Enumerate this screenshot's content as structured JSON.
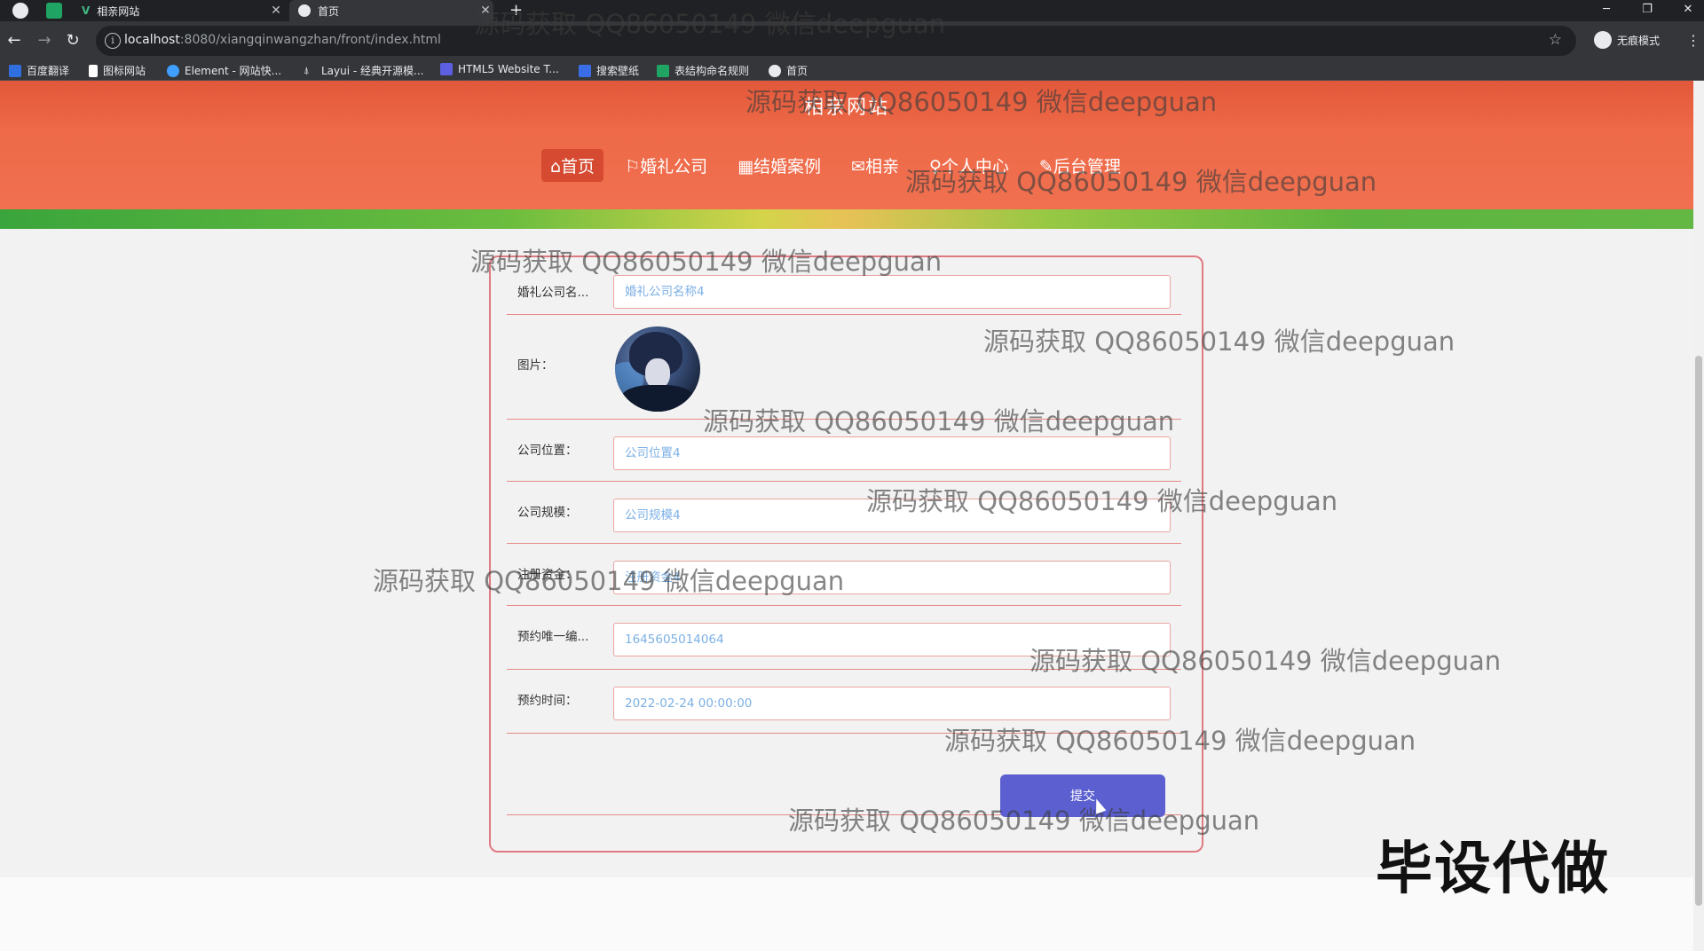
{
  "browser": {
    "tabs": [
      {
        "title": "相亲网站",
        "close": "✕"
      },
      {
        "title": "首页",
        "close": "✕"
      }
    ],
    "new_tab": "+",
    "window_controls": [
      "─",
      "❐",
      "✕"
    ],
    "url_host": "localhost",
    "url_rest": ":8080/xiangqinwangzhan/front/index.html",
    "profile_label": "无痕模式",
    "bookmarks": [
      {
        "label": "百度翻译",
        "icon": "baidu-translate-icon",
        "color": "#2f6fdf"
      },
      {
        "label": "图标网站",
        "icon": "flag-icon",
        "color": "#ffffff"
      },
      {
        "label": "Element - 网站快...",
        "icon": "element-icon",
        "color": "#409eff"
      },
      {
        "label": "Layui - 经典开源模...",
        "icon": "layui-icon",
        "color": "#e8eaed"
      },
      {
        "label": "HTML5 Website T...",
        "icon": "html5-icon",
        "color": "#5b5fe0"
      },
      {
        "label": "搜索壁纸",
        "icon": "wallpaper-icon",
        "color": "#3a6ee8"
      },
      {
        "label": "表结构命名规则",
        "icon": "sheet-icon",
        "color": "#1fa463"
      },
      {
        "label": "首页",
        "icon": "globe-icon",
        "color": "#e8eaed"
      }
    ]
  },
  "site": {
    "title": "相亲网站",
    "nav": [
      {
        "label": "⌂首页",
        "active": true
      },
      {
        "label": "⚐婚礼公司",
        "active": false
      },
      {
        "label": "▦结婚案例",
        "active": false
      },
      {
        "label": "✉相亲",
        "active": false
      },
      {
        "label": "♀个人中心",
        "active": false
      },
      {
        "label": "✎后台管理",
        "active": false
      }
    ]
  },
  "form": {
    "fields": [
      {
        "label": "婚礼公司名...",
        "value": "婚礼公司名称4"
      },
      {
        "label": "图片：",
        "value": ""
      },
      {
        "label": "公司位置：",
        "value": "公司位置4"
      },
      {
        "label": "公司规模：",
        "value": "公司规模4"
      },
      {
        "label": "注册资金：",
        "value": "注册资金4"
      },
      {
        "label": "预约唯一编...",
        "value": "1645605014064"
      },
      {
        "label": "预约时间：",
        "value": "2022-02-24 00:00:00"
      }
    ],
    "submit_label": "提交"
  },
  "watermark": "源码获取 QQ86050149 微信deepguan",
  "overlay_tag": "毕设代做",
  "colors": {
    "header": "#ee6a48",
    "nav_active": "#d54a31",
    "submit": "#5b5fcf",
    "form_border": "#e07a82",
    "input_text": "#7cb0e5"
  }
}
